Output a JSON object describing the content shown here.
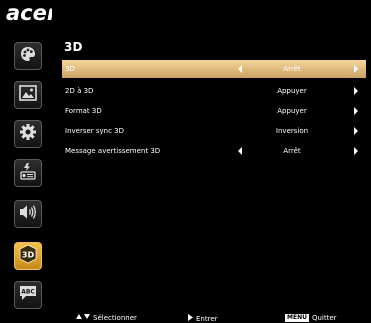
{
  "brand": {
    "logo_text": "acer"
  },
  "sidebar": {
    "items": [
      {
        "icon": "palette-icon"
      },
      {
        "icon": "image-icon"
      },
      {
        "icon": "gear-icon"
      },
      {
        "icon": "power-management-icon"
      },
      {
        "icon": "speaker-icon"
      },
      {
        "icon": "3d-icon",
        "active": true
      },
      {
        "icon": "language-abc-icon"
      }
    ]
  },
  "main": {
    "title": "3D",
    "rows": [
      {
        "label": "3D",
        "value": "Arrêt",
        "left_arrow": true,
        "right_arrow": true,
        "selected": true
      },
      {
        "label": "2D à 3D",
        "value": "Appuyer",
        "left_arrow": false,
        "right_arrow": true
      },
      {
        "label": "Format 3D",
        "value": "Appuyer",
        "left_arrow": false,
        "right_arrow": true
      },
      {
        "label": "Inverser sync 3D",
        "value": "Inversion",
        "left_arrow": false,
        "right_arrow": true
      },
      {
        "label": "Message avertissement 3D",
        "value": "Arrêt",
        "left_arrow": true,
        "right_arrow": true
      }
    ]
  },
  "footer": {
    "select_label": "Sélectionner",
    "enter_label": "Entrer",
    "menu_key": "MENU",
    "quit_label": "Quitter"
  },
  "colors": {
    "background": "#000000",
    "selected_row": "#e4bd7a",
    "active_tab": "#e8aa34"
  }
}
